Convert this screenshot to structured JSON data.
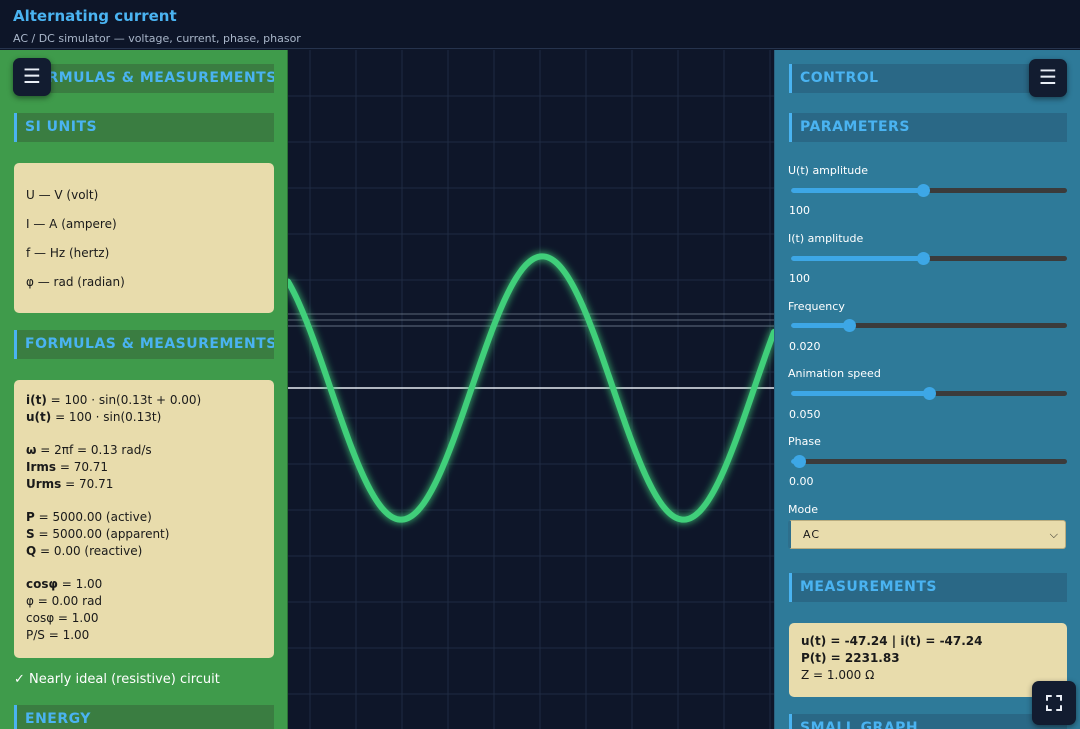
{
  "header": {
    "title": "Alternating current",
    "subtitle": "AC / DC simulator — voltage, current, phase, phasor"
  },
  "left": {
    "top_heading": "FORMULAS & MEASUREMENTS",
    "si_heading": "SI UNITS",
    "si_units": [
      "U — V (volt)",
      "I — A (ampere)",
      "f — Hz (hertz)",
      "φ — rad (radian)"
    ],
    "formulas_heading": "FORMULAS & MEASUREMENTS",
    "formulas": {
      "i_t": {
        "key": "i(t)",
        "text": " = 100 · sin(0.13t + 0.00)"
      },
      "u_t": {
        "key": "u(t)",
        "text": " = 100 · sin(0.13t)"
      },
      "omega": {
        "key": "ω",
        "text": " = 2πf = 0.13 rad/s"
      },
      "irms": {
        "key": "Irms",
        "text": " = 70.71"
      },
      "urms": {
        "key": "Urms",
        "text": " = 70.71"
      },
      "p": {
        "key": "P",
        "text": " = 5000.00 (active)"
      },
      "s": {
        "key": "S",
        "text": " = 5000.00 (apparent)"
      },
      "q": {
        "key": "Q",
        "text": " = 0.00 (reactive)"
      },
      "cosphi_bold": {
        "key": "cosφ",
        "text": " = 1.00"
      },
      "phi": "φ = 0.00 rad",
      "cosphi": "cosφ = 1.00",
      "ps": "P/S = 1.00"
    },
    "ideal_note": "✓ Nearly ideal (resistive) circuit",
    "energy_heading": "ENERGY"
  },
  "right": {
    "control_heading": "CONTROL",
    "parameters_heading": "PARAMETERS",
    "params": [
      {
        "label": "U(t) amplitude",
        "value": "100",
        "fraction": 0.48
      },
      {
        "label": "I(t) amplitude",
        "value": "100",
        "fraction": 0.48
      },
      {
        "label": "Frequency",
        "value": "0.020",
        "fraction": 0.21
      },
      {
        "label": "Animation speed",
        "value": "0.050",
        "fraction": 0.5
      },
      {
        "label": "Phase",
        "value": "0.00",
        "fraction": 0.03
      }
    ],
    "mode_label": "Mode",
    "mode_value": "AC",
    "measurements_heading": "MEASUREMENTS",
    "measurements": {
      "ui": "u(t) = -47.24 | i(t) = -47.24",
      "pt": "P(t) = 2231.83",
      "z": "Z = 1.000 Ω"
    },
    "small_graph_heading": "SMALL GRAPH"
  },
  "icons": {
    "menu": "hamburger-menu-icon",
    "fullscreen": "fullscreen-icon"
  },
  "colors": {
    "accent": "#4ab3f1",
    "wave": "#3fcf7a",
    "left_panel": "#3f9b4b",
    "right_panel": "#2e7a99",
    "card": "#e8dcac"
  },
  "wave": {
    "amplitude": 100,
    "y_max": 120,
    "cycles_visible": 1.72,
    "phase_offset": 0.35
  }
}
